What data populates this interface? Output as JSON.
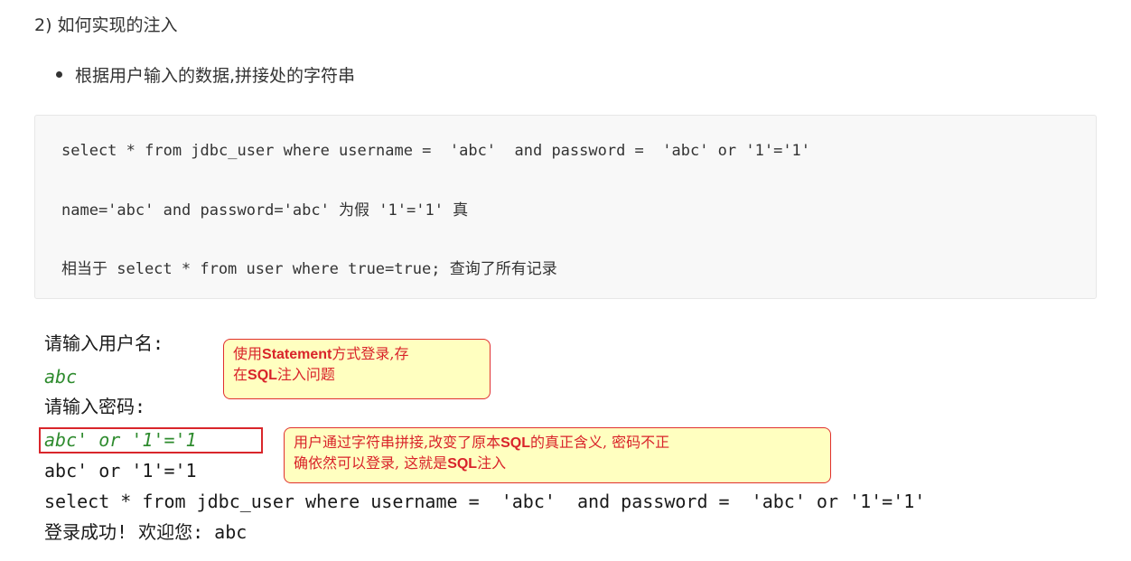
{
  "heading": "2) 如何实现的注入",
  "bullet": "根据用户输入的数据,拼接处的字符串",
  "code_block": {
    "line1": "select * from jdbc_user where username =  'abc'  and password =  'abc' or '1'='1'",
    "line2": "name='abc' and password='abc' 为假 '1'='1' 真",
    "line3": "相当于 select * from user where true=true; 查询了所有记录"
  },
  "console": {
    "prompt_username": "请输入用户名:",
    "username_input": "abc",
    "prompt_password": "请输入密码:",
    "password_input": "abc' or '1'='1",
    "echo_password": "abc' or '1'='1",
    "sql_output": "select * from jdbc_user where username =  'abc'  and password =  'abc' or '1'='1'",
    "login_result": "登录成功! 欢迎您: abc"
  },
  "callouts": {
    "statement": {
      "part1": "使用",
      "part2_bold": "Statement",
      "part3": "方式登录,存",
      "part4": "在",
      "part5_bold": "SQL",
      "part6": "注入问题"
    },
    "concat": {
      "part1": "用户通过字符串拼接,改变了原本",
      "part2_bold": "SQL",
      "part3": "的真正含义, 密码不正",
      "part4": "确依然可以登录, 这就是",
      "part5_bold": "SQL",
      "part6": "注入"
    }
  },
  "colors": {
    "callout_bg": "#ffffc0",
    "callout_border": "#e0302f",
    "callout_text": "#d9232a",
    "input_text": "#2e8b2e",
    "highlight_border": "#d9262b",
    "code_bg": "#f8f8f8"
  }
}
